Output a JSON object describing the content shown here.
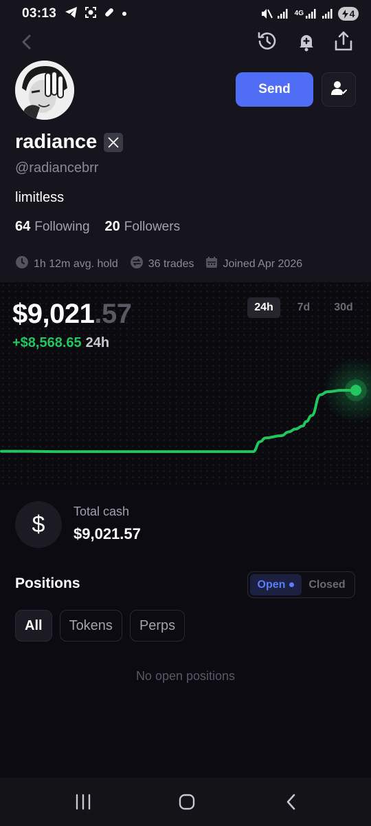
{
  "status_bar": {
    "time": "03:13",
    "left_icons": [
      "telegram-icon",
      "screenshot-icon",
      "capsule-icon",
      "dot-icon"
    ],
    "right_icons": [
      "mute-icon",
      "signal-icon",
      "4g-signal-icon",
      "signal-icon-2"
    ],
    "network_label": "4G",
    "battery": "4"
  },
  "header": {
    "icons": [
      "back-chevron-icon",
      "history-icon",
      "bell-plus-icon",
      "share-icon"
    ]
  },
  "profile": {
    "name": "radiance",
    "badge_icon": "x-logo-icon",
    "handle": "@radiancebrr",
    "bio": "limitless",
    "following_count": "64",
    "following_label": "Following",
    "followers_count": "20",
    "followers_label": "Followers",
    "send_label": "Send",
    "follow_icon": "user-check-icon",
    "meta": {
      "hold": "1h 12m avg. hold",
      "trades": "36 trades",
      "joined": "Joined Apr 2026"
    }
  },
  "portfolio": {
    "balance_main": "$9,021",
    "balance_cents": ".57",
    "pnl": "+$8,568.65",
    "pnl_period": "24h",
    "ranges": [
      "24h",
      "7d",
      "30d"
    ],
    "active_range": "24h",
    "line_color": "#22c55e"
  },
  "chart_data": {
    "type": "line",
    "x": [
      0,
      0.03,
      0.07,
      0.15,
      0.3,
      0.5,
      0.71,
      0.73,
      0.745,
      0.79,
      0.81,
      0.83,
      0.85,
      0.86,
      0.875,
      0.9,
      0.92,
      0.96,
      1.0
    ],
    "values": [
      200,
      200,
      200,
      180,
      180,
      180,
      180,
      850,
      1100,
      1250,
      1500,
      1700,
      1900,
      2200,
      2600,
      4000,
      4200,
      4300,
      4300
    ],
    "title": "",
    "xlabel": "",
    "ylabel": ""
  },
  "cash": {
    "icon_symbol": "$",
    "label": "Total cash",
    "value": "$9,021.57"
  },
  "positions": {
    "title": "Positions",
    "open_label": "Open",
    "closed_label": "Closed",
    "filters": [
      "All",
      "Tokens",
      "Perps"
    ],
    "active_filter": "All",
    "empty_text": "No open positions"
  },
  "nav": {
    "icons": [
      "recents-icon",
      "home-icon",
      "back-icon"
    ]
  }
}
